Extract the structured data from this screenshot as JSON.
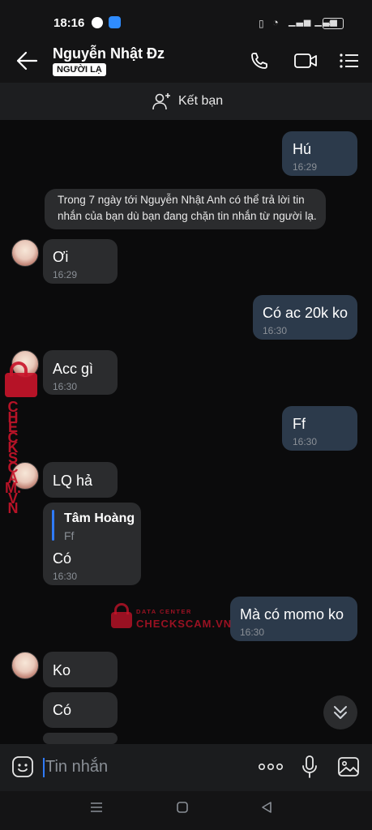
{
  "status_bar": {
    "time": "18:16",
    "battery": "84",
    "signal_label": "Vo LTE"
  },
  "header": {
    "name": "Nguyễn Nhật Đz",
    "badge": "NGƯỜI LẠ",
    "icons": [
      "back-arrow-icon",
      "phone-icon",
      "video-call-icon",
      "menu-icon"
    ]
  },
  "add_friend": {
    "label": "Kết bạn"
  },
  "messages": [
    {
      "side": "out",
      "text": "Hú",
      "time": "16:29"
    },
    {
      "side": "system",
      "line1": "Trong 7 ngày tới Nguyễn Nhật Anh có thể trả lời tin",
      "line2": "nhắn của bạn dù bạn đang chặn tin nhắn từ người lạ."
    },
    {
      "side": "in",
      "text": "Ơi",
      "time": "16:29"
    },
    {
      "side": "out",
      "text": "Có ac 20k ko",
      "time": "16:30"
    },
    {
      "side": "in",
      "text": "Acc gì",
      "time": "16:30"
    },
    {
      "side": "out",
      "text": "Ff",
      "time": "16:30"
    },
    {
      "side": "in",
      "text": "LQ hả"
    },
    {
      "side": "in",
      "quote_author": "Tâm Hoàng",
      "quote_text": "Ff",
      "text": "Có",
      "time": "16:30"
    },
    {
      "side": "out",
      "text": "Mà có momo ko",
      "time": "16:30"
    },
    {
      "side": "in",
      "text": "Ko"
    },
    {
      "side": "in",
      "text": "Có"
    }
  ],
  "watermark": {
    "line1": "DATA CENTER",
    "line2": "CHECKSCAM.VN",
    "color": "#c9142a"
  },
  "input": {
    "placeholder": "Tin nhắn"
  },
  "colors": {
    "outgoing_bubble": "#2c3a4b",
    "incoming_bubble": "#2b2c2e",
    "accent": "#2f7bff"
  }
}
